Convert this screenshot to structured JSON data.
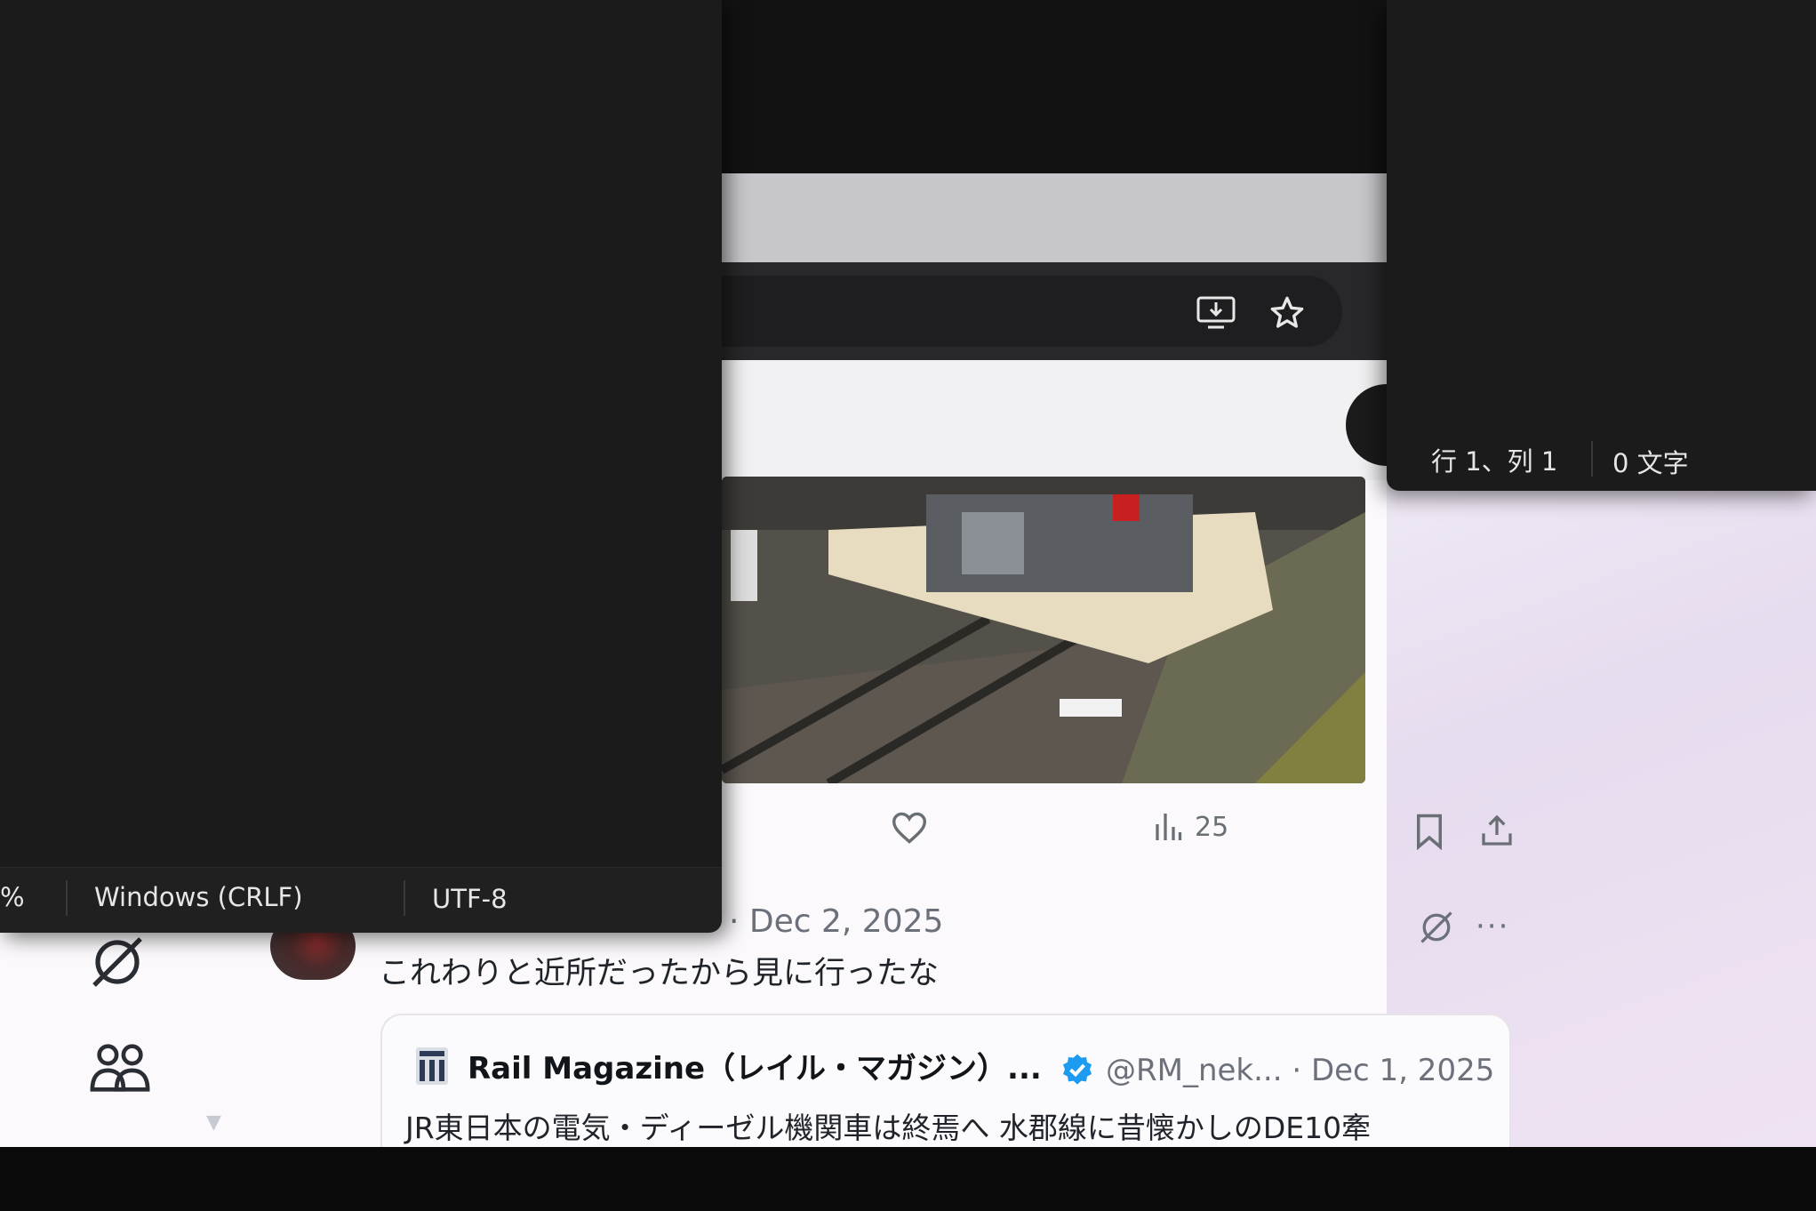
{
  "tweet": {
    "views_count": "25"
  },
  "reply": {
    "date": "· Dec 2, 2025",
    "text": "これわりと近所だったから見に行ったな"
  },
  "quote": {
    "name": "Rail Magazine（レイル・マガジン）...",
    "handle": "@RM_nek...  · Dec 1, 2025",
    "text": "JR東日本の電気・ディーゼル機関車は終焉へ 水郡線に昔懐かしのDE10牽"
  },
  "notepad_left_status": {
    "zoom": "%",
    "line_ending": "Windows (CRLF)",
    "encoding": "UTF-8"
  },
  "notepad_right_status": {
    "position": "行 1、列 1",
    "char_count": "0 文字"
  },
  "colors": {
    "notepad_bg": "#1b1b1b",
    "page_bg": "#fbf9fb",
    "verified_blue": "#1d9bf0",
    "muted_text": "#6b707a"
  },
  "icons": [
    "install-app-icon",
    "star-icon",
    "heart-icon",
    "views-chart-icon",
    "bookmark-icon",
    "share-icon",
    "grok-icon",
    "communities-icon",
    "more-icon",
    "verified-badge-icon"
  ]
}
